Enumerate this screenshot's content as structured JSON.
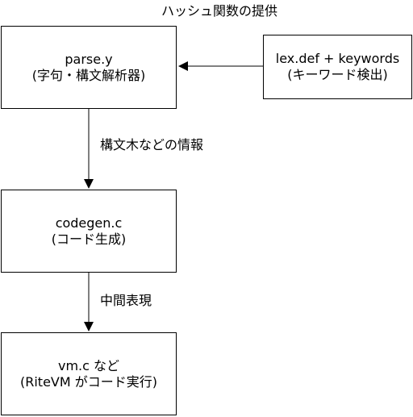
{
  "title": "ハッシュ関数の提供",
  "nodes": {
    "parser": {
      "line1": "parse.y",
      "line2": "(字句・構文解析器)"
    },
    "lexdef": {
      "line1": "lex.def + keywords",
      "line2": "(キーワード検出)"
    },
    "codegen": {
      "line1": "codegen.c",
      "line2": "(コード生成)"
    },
    "vm": {
      "line1": "vm.c など",
      "line2": "(RiteVM がコード実行)"
    }
  },
  "edges": {
    "parser_to_codegen": "構文木などの情報",
    "codegen_to_vm": "中間表現"
  }
}
